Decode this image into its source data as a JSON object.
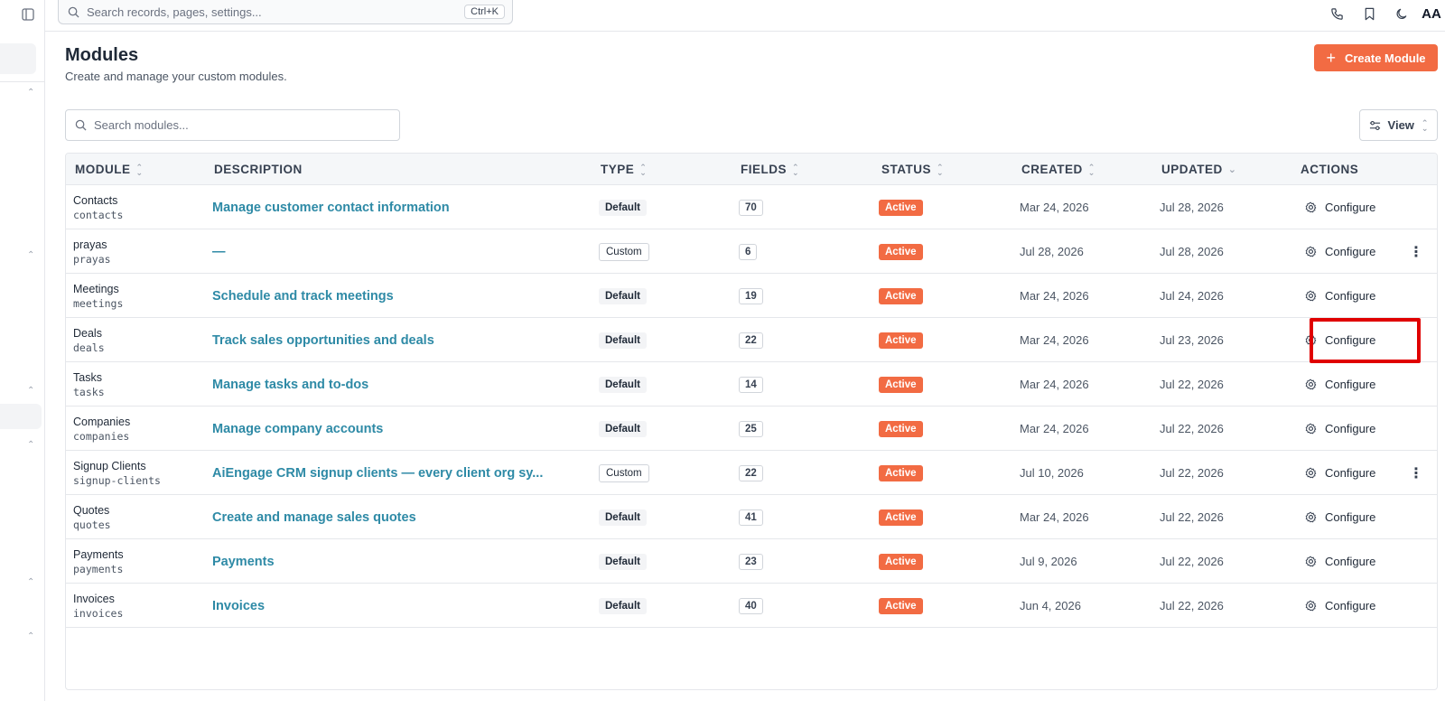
{
  "topbar": {
    "search_placeholder": "Search records, pages, settings...",
    "shortcut": "Ctrl+K",
    "avatar_initials": "AA"
  },
  "page": {
    "title": "Modules",
    "subtitle": "Create and manage your custom modules.",
    "create_label": "Create Module",
    "accent_color": "#f26b43"
  },
  "filters": {
    "search_placeholder": "Search modules...",
    "view_label": "View"
  },
  "table": {
    "columns": [
      "MODULE",
      "DESCRIPTION",
      "TYPE",
      "FIELDS",
      "STATUS",
      "CREATED",
      "UPDATED",
      "ACTIONS"
    ],
    "action_label": "Configure",
    "rows": [
      {
        "name": "Contacts",
        "slug": "contacts",
        "description": "Manage customer contact information",
        "type": "Default",
        "fields": "70",
        "status": "Active",
        "created": "Mar 24, 2026",
        "updated": "Jul 28, 2026",
        "more": false
      },
      {
        "name": "prayas",
        "slug": "prayas",
        "description": "—",
        "type": "Custom",
        "fields": "6",
        "status": "Active",
        "created": "Jul 28, 2026",
        "updated": "Jul 28, 2026",
        "more": true
      },
      {
        "name": "Meetings",
        "slug": "meetings",
        "description": "Schedule and track meetings",
        "type": "Default",
        "fields": "19",
        "status": "Active",
        "created": "Mar 24, 2026",
        "updated": "Jul 24, 2026",
        "more": false
      },
      {
        "name": "Deals",
        "slug": "deals",
        "description": "Track sales opportunities and deals",
        "type": "Default",
        "fields": "22",
        "status": "Active",
        "created": "Mar 24, 2026",
        "updated": "Jul 23, 2026",
        "more": false
      },
      {
        "name": "Tasks",
        "slug": "tasks",
        "description": "Manage tasks and to-dos",
        "type": "Default",
        "fields": "14",
        "status": "Active",
        "created": "Mar 24, 2026",
        "updated": "Jul 22, 2026",
        "more": false
      },
      {
        "name": "Companies",
        "slug": "companies",
        "description": "Manage company accounts",
        "type": "Default",
        "fields": "25",
        "status": "Active",
        "created": "Mar 24, 2026",
        "updated": "Jul 22, 2026",
        "more": false
      },
      {
        "name": "Signup Clients",
        "slug": "signup-clients",
        "description": "AiEngage CRM signup clients — every client org sy...",
        "type": "Custom",
        "fields": "22",
        "status": "Active",
        "created": "Jul 10, 2026",
        "updated": "Jul 22, 2026",
        "more": true
      },
      {
        "name": "Quotes",
        "slug": "quotes",
        "description": "Create and manage sales quotes",
        "type": "Default",
        "fields": "41",
        "status": "Active",
        "created": "Mar 24, 2026",
        "updated": "Jul 22, 2026",
        "more": false
      },
      {
        "name": "Payments",
        "slug": "payments",
        "description": "Payments",
        "type": "Default",
        "fields": "23",
        "status": "Active",
        "created": "Jul 9, 2026",
        "updated": "Jul 22, 2026",
        "more": false
      },
      {
        "name": "Invoices",
        "slug": "invoices",
        "description": "Invoices",
        "type": "Default",
        "fields": "40",
        "status": "Active",
        "created": "Jun 4, 2026",
        "updated": "Jul 22, 2026",
        "more": false
      }
    ]
  }
}
